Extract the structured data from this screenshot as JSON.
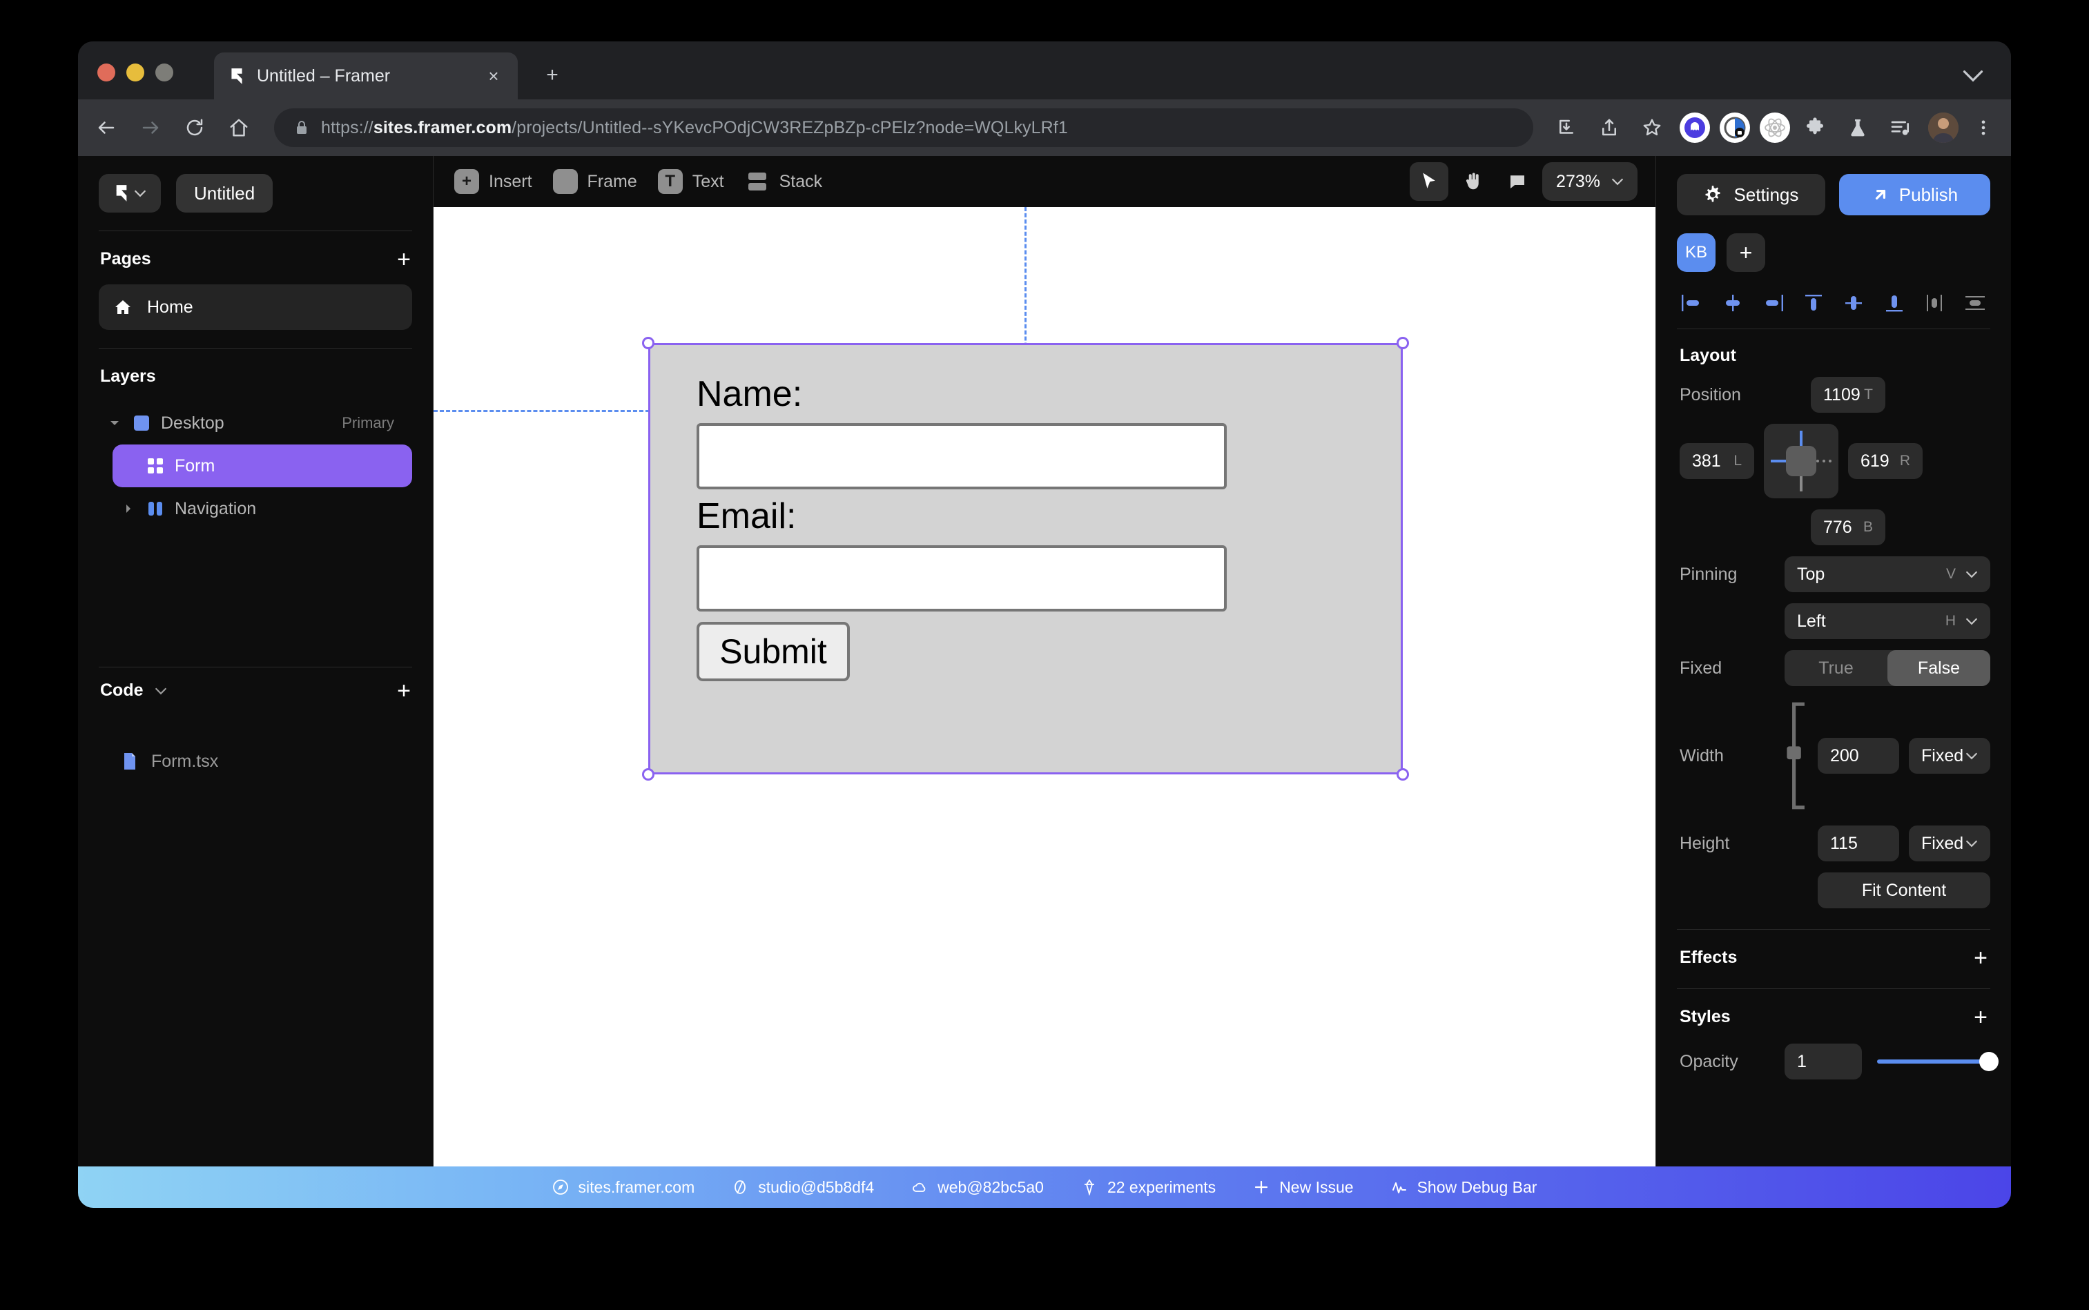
{
  "browser": {
    "tab": {
      "title": "Untitled – Framer",
      "favicon": "framer-logo-icon",
      "close": "×"
    },
    "new_tab": "+",
    "url_prefix": "https://",
    "url_host": "sites.framer.com",
    "url_path": "/projects/Untitled--sYKevcPOdjCW3REZpBZp-cPElz?node=WQLkyLRf1",
    "toolbar_icons": [
      "back-icon",
      "forward-icon",
      "reload-icon",
      "home-icon"
    ],
    "right_icons": [
      "download-icon",
      "share-icon",
      "bookmark-star-icon"
    ],
    "extensions": [
      "ghost-extension-icon",
      "lock-timer-extension-icon",
      "react-devtools-icon",
      "puzzle-extensions-icon",
      "flask-experiments-icon",
      "reading-list-icon"
    ],
    "profile": "user-avatar",
    "menu": "three-dot-menu-icon",
    "tab_list_chevron": "chevron-down-icon"
  },
  "sidebar": {
    "logo": "framer-logo-icon",
    "project_name": "Untitled",
    "pages": {
      "title": "Pages",
      "add": "+",
      "items": [
        {
          "label": "Home",
          "icon": "home-icon"
        }
      ]
    },
    "layers": {
      "title": "Layers",
      "items": [
        {
          "label": "Desktop",
          "badge": "Primary",
          "icon": "frame-square-icon",
          "selected": false,
          "expanded": true,
          "depth": 0
        },
        {
          "label": "Form",
          "badge": "",
          "icon": "component-grid-icon",
          "selected": true,
          "expanded": false,
          "depth": 1
        },
        {
          "label": "Navigation",
          "badge": "",
          "icon": "stack-columns-icon",
          "selected": false,
          "expanded": false,
          "depth": 1
        }
      ]
    },
    "code": {
      "title": "Code",
      "add": "+",
      "items": [
        {
          "label": "Form.tsx",
          "icon": "file-code-icon"
        }
      ]
    }
  },
  "topbar": {
    "tools": [
      {
        "label": "Insert",
        "icon": "plus-square-icon"
      },
      {
        "label": "Frame",
        "icon": "frame-icon"
      },
      {
        "label": "Text",
        "icon": "text-t-icon"
      },
      {
        "label": "Stack",
        "icon": "stack-icon"
      }
    ],
    "mode_icons": [
      "cursor-arrow-icon",
      "hand-pan-icon",
      "comment-bubble-icon"
    ],
    "zoom": "273%",
    "zoom_chevron": "chevron-down-icon"
  },
  "canvas": {
    "form": {
      "name_label": "Name:",
      "email_label": "Email:",
      "submit_label": "Submit",
      "name_value": "",
      "email_value": "",
      "background": "#d3d3d3",
      "selection_color": "#8a62f0"
    }
  },
  "rightpanel": {
    "settings_label": "Settings",
    "settings_icon": "gear-icon",
    "publish_label": "Publish",
    "publish_icon": "arrow-up-right-icon",
    "avatar_initials": "KB",
    "avatar_add": "+",
    "align_icons": [
      "align-left-icon",
      "align-center-horizontal-icon",
      "align-right-icon",
      "align-top-icon",
      "align-center-vertical-icon",
      "align-bottom-icon",
      "distribute-horizontal-icon",
      "distribute-vertical-icon"
    ],
    "layout": {
      "title": "Layout",
      "position_label": "Position",
      "top": "1109",
      "top_suffix": "T",
      "left": "381",
      "left_suffix": "L",
      "right": "619",
      "right_suffix": "R",
      "bottom": "776",
      "bottom_suffix": "B",
      "pinning_label": "Pinning",
      "pin_vertical": "Top",
      "pin_vertical_suffix": "V",
      "pin_horizontal": "Left",
      "pin_horizontal_suffix": "H",
      "fixed_label": "Fixed",
      "fixed_true": "True",
      "fixed_false": "False",
      "fixed_selected": "False",
      "width_label": "Width",
      "width_value": "200",
      "width_mode": "Fixed",
      "height_label": "Height",
      "height_value": "115",
      "height_mode": "Fixed",
      "fit_content": "Fit Content"
    },
    "effects": {
      "title": "Effects",
      "add": "+"
    },
    "styles": {
      "title": "Styles",
      "add": "+"
    },
    "opacity": {
      "label": "Opacity",
      "value": "1"
    }
  },
  "debugbar": {
    "items": [
      {
        "label": "sites.framer.com",
        "icon": "compass-icon"
      },
      {
        "label": "studio@d5b8df4",
        "icon": "slash-circle-icon"
      },
      {
        "label": "web@82bc5a0",
        "icon": "cloud-icon"
      },
      {
        "label": "22 experiments",
        "icon": "diamond-icon"
      },
      {
        "label": "New Issue",
        "icon": "plus-icon"
      },
      {
        "label": "Show Debug Bar",
        "icon": "pulse-icon"
      }
    ]
  }
}
